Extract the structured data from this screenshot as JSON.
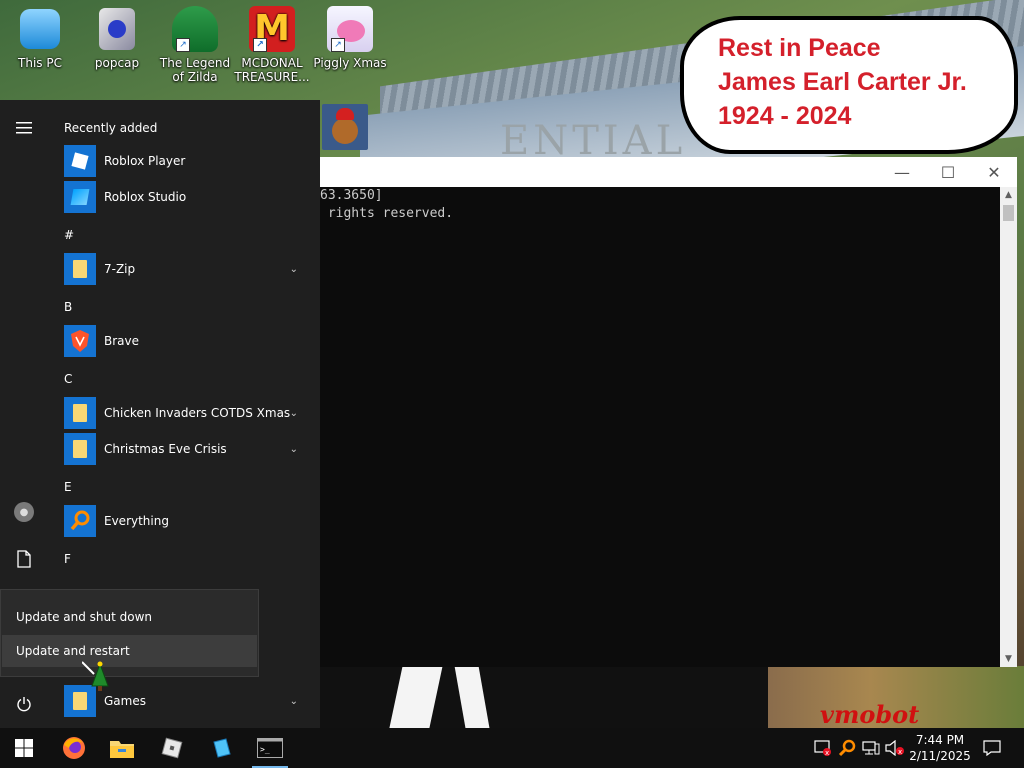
{
  "desktop_icons": [
    {
      "label": "This PC",
      "icon": "this-pc-icon"
    },
    {
      "label": "popcap",
      "icon": "popcap-icon"
    },
    {
      "label": "The Legend of Zilda",
      "icon": "zilda-icon"
    },
    {
      "label": "MCDONAL TREASURE...",
      "icon": "mcdonalds-icon"
    },
    {
      "label": "Piggly Xmas",
      "icon": "piggly-icon"
    }
  ],
  "wallpaper": {
    "banner_lines": [
      "Rest in Peace",
      "James Earl Carter Jr.",
      "1924 - 2024"
    ],
    "building_text": "ENTIAL",
    "watermark": "vmobot"
  },
  "cmd_window": {
    "lines": [
      "63.3650]",
      " rights reserved."
    ]
  },
  "start_menu": {
    "recently_added_label": "Recently added",
    "recent": [
      {
        "label": "Roblox Player",
        "icon": "roblox-player-icon"
      },
      {
        "label": "Roblox Studio",
        "icon": "roblox-studio-icon"
      }
    ],
    "sections": {
      "hash": "#",
      "b": "B",
      "c": "C",
      "e": "E",
      "f": "F"
    },
    "apps": {
      "seven_zip": "7-Zip",
      "brave": "Brave",
      "chicken": "Chicken Invaders COTDS Xmas",
      "christmas": "Christmas Eve Crisis",
      "everything": "Everything",
      "games": "Games"
    }
  },
  "power_menu": {
    "items": [
      "Update and shut down",
      "Update and restart"
    ],
    "highlighted": "Update and restart"
  },
  "taskbar": {
    "pinned": [
      "start-button",
      "firefox-icon",
      "file-explorer-icon",
      "roblox-icon",
      "roblox-studio-icon",
      "command-prompt-icon"
    ],
    "time": "7:44 PM",
    "date": "2/11/2025"
  }
}
